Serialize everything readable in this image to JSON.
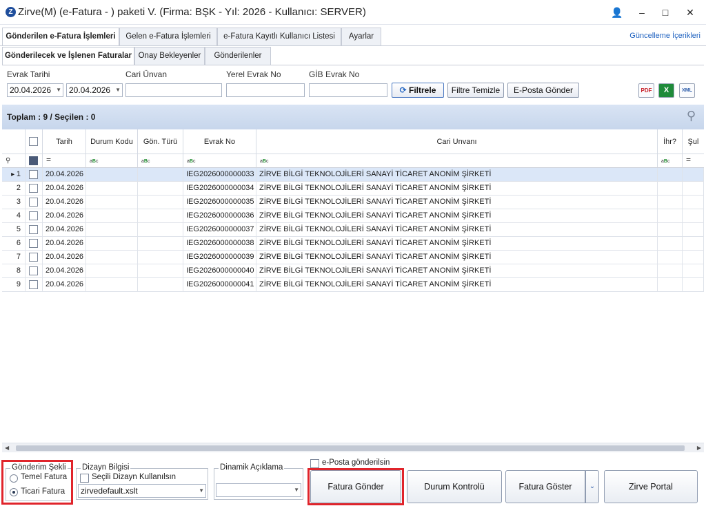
{
  "window": {
    "title": "Zirve(M)  (e-Fatura - ) paketi V. (Firma: BŞK - Yıl: 2026 - Kullanıcı: SERVER)",
    "app_icon": "zirve-logo-icon",
    "controls": {
      "user": "👤",
      "minimize": "–",
      "maximize": "□",
      "close": "✕"
    }
  },
  "tabs": [
    {
      "label": "Gönderilen e-Fatura İşlemleri",
      "active": true
    },
    {
      "label": "Gelen e-Fatura İşlemleri",
      "active": false
    },
    {
      "label": "e-Fatura Kayıtlı Kullanıcı Listesi",
      "active": false
    },
    {
      "label": "Ayarlar",
      "active": false
    }
  ],
  "guncelleme_link": "Güncelleme İçerikleri",
  "subtabs": [
    {
      "label": "Gönderilecek ve İşlenen Faturalar",
      "active": true
    },
    {
      "label": "Onay Bekleyenler",
      "active": false
    },
    {
      "label": "Gönderilenler",
      "active": false
    }
  ],
  "filters": {
    "evrak_tarihi_label": "Evrak Tarihi",
    "date_from": "20.04.2026",
    "date_to": "20.04.2026",
    "cari_unvan_label": "Cari Ünvan",
    "cari_unvan_value": "",
    "yerel_evrak_no_label": "Yerel Evrak No",
    "yerel_evrak_no_value": "",
    "gib_evrak_no_label": "GİB Evrak No",
    "gib_evrak_no_value": "",
    "filtrele_label": "Filtrele",
    "filtre_temizle_label": "Filtre Temizle",
    "eposta_gonder_label": "E-Posta Gönder",
    "export_pdf": "PDF",
    "export_excel": "X",
    "export_xml": "XML"
  },
  "summary": {
    "toplam_text": "Toplam : 9 / Seçilen : 0"
  },
  "grid": {
    "columns": [
      "Tarih",
      "Durum Kodu",
      "Gön. Türü",
      "Evrak No",
      "Cari Unvanı",
      "İhr?",
      "Şul"
    ],
    "filter_row": {
      "equals": "=",
      "abc_left": "a",
      "abc_mid": "B",
      "abc_right": "c"
    },
    "rows": [
      {
        "num": "1",
        "tarih": "20.04.2026",
        "durum": "",
        "gon": "",
        "evrak": "IEG2026000000033",
        "cari": "ZİRVE BİLGİ TEKNOLOJİLERİ SANAYİ TİCARET ANONİM ŞİRKETİ",
        "selected": true
      },
      {
        "num": "2",
        "tarih": "20.04.2026",
        "durum": "",
        "gon": "",
        "evrak": "IEG2026000000034",
        "cari": "ZİRVE BİLGİ TEKNOLOJİLERİ SANAYİ TİCARET ANONİM ŞİRKETİ",
        "selected": false
      },
      {
        "num": "3",
        "tarih": "20.04.2026",
        "durum": "",
        "gon": "",
        "evrak": "IEG2026000000035",
        "cari": "ZİRVE BİLGİ TEKNOLOJİLERİ SANAYİ TİCARET ANONİM ŞİRKETİ",
        "selected": false
      },
      {
        "num": "4",
        "tarih": "20.04.2026",
        "durum": "",
        "gon": "",
        "evrak": "IEG2026000000036",
        "cari": "ZİRVE BİLGİ TEKNOLOJİLERİ SANAYİ TİCARET ANONİM ŞİRKETİ",
        "selected": false
      },
      {
        "num": "5",
        "tarih": "20.04.2026",
        "durum": "",
        "gon": "",
        "evrak": "IEG2026000000037",
        "cari": "ZİRVE BİLGİ TEKNOLOJİLERİ SANAYİ TİCARET ANONİM ŞİRKETİ",
        "selected": false
      },
      {
        "num": "6",
        "tarih": "20.04.2026",
        "durum": "",
        "gon": "",
        "evrak": "IEG2026000000038",
        "cari": "ZİRVE BİLGİ TEKNOLOJİLERİ SANAYİ TİCARET ANONİM ŞİRKETİ",
        "selected": false
      },
      {
        "num": "7",
        "tarih": "20.04.2026",
        "durum": "",
        "gon": "",
        "evrak": "IEG2026000000039",
        "cari": "ZİRVE BİLGİ TEKNOLOJİLERİ SANAYİ TİCARET ANONİM ŞİRKETİ",
        "selected": false
      },
      {
        "num": "8",
        "tarih": "20.04.2026",
        "durum": "",
        "gon": "",
        "evrak": "IEG2026000000040",
        "cari": "ZİRVE BİLGİ TEKNOLOJİLERİ SANAYİ TİCARET ANONİM ŞİRKETİ",
        "selected": false
      },
      {
        "num": "9",
        "tarih": "20.04.2026",
        "durum": "",
        "gon": "",
        "evrak": "IEG2026000000041",
        "cari": "ZİRVE BİLGİ TEKNOLOJİLERİ SANAYİ TİCARET ANONİM ŞİRKETİ",
        "selected": false
      }
    ]
  },
  "bottom": {
    "gonderim_sekli_title": "Gönderim Şekli",
    "temel_fatura_label": "Temel Fatura",
    "ticari_fatura_label": "Ticari Fatura",
    "selected_gonderim": "Ticari Fatura",
    "dizayn_title": "Dizayn Bilgisi",
    "secili_dizayn_label": "Seçili Dizayn Kullanılsın",
    "dizayn_value": "zirvedefault.xslt",
    "dinamik_title": "Dinamik Açıklama",
    "dinamik_value": "",
    "eposta_gonderilsin_label": "e-Posta gönderilsin",
    "fatura_gonder_label": "Fatura Gönder",
    "durum_kontrolu_label": "Durum Kontrolü",
    "fatura_goster_label": "Fatura Göster",
    "zirve_portal_label": "Zirve Portal"
  },
  "colors": {
    "accent": "#1f62c0",
    "highlight_red": "#e0242b",
    "selected_row": "#dbe7f8",
    "group_bar": "#c7d6ec"
  }
}
